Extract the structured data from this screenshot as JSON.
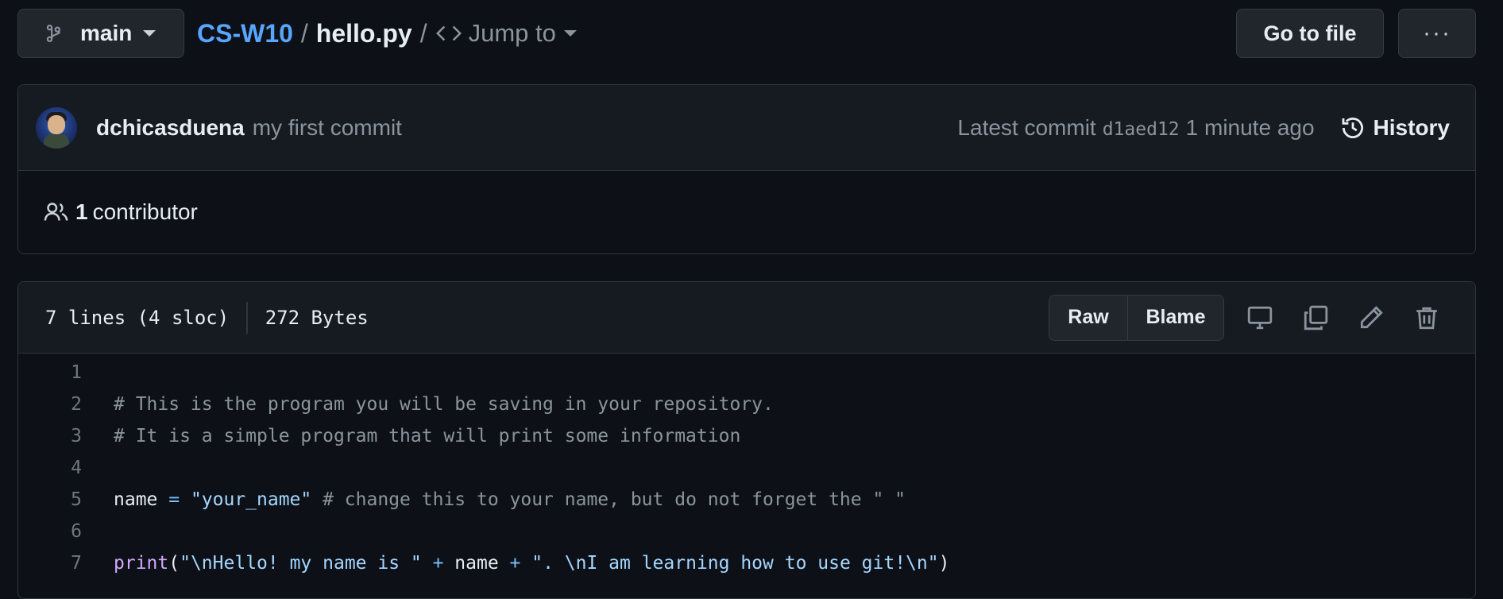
{
  "topbar": {
    "branch": "main",
    "repo": "CS-W10",
    "separator": "/",
    "file": "hello.py",
    "jump_label": "Jump to",
    "goto_label": "Go to file",
    "more_label": "···"
  },
  "commit": {
    "author": "dchicasduena",
    "message": "my first commit",
    "latest_label": "Latest commit",
    "sha": "d1aed12",
    "time": "1 minute ago",
    "history_label": "History"
  },
  "contributors": {
    "count": "1",
    "label": "contributor"
  },
  "file": {
    "lines_info": "7 lines (4 sloc)",
    "size": "272 Bytes",
    "raw_label": "Raw",
    "blame_label": "Blame"
  },
  "code": {
    "line_numbers": [
      "1",
      "2",
      "3",
      "4",
      "5",
      "6",
      "7"
    ],
    "l2": "# This is the program you will be saving in your repository.",
    "l3": "# It is a simple program that will print some information",
    "l5_name": "name",
    "l5_eq": " = ",
    "l5_str": "\"your_name\"",
    "l5_comment": " # change this to your name, but do not forget the \" \"",
    "l7_fn": "print",
    "l7_open": "(",
    "l7_str1": "\"\\nHello! my name is \"",
    "l7_plus1": " + ",
    "l7_name": "name",
    "l7_plus2": " + ",
    "l7_str2": "\". \\nI am learning how to use git!\\n\"",
    "l7_close": ")"
  },
  "colors": {
    "link": "#58a6ff",
    "background": "#0d1117",
    "panel": "#161b22",
    "muted": "#8b949e"
  }
}
